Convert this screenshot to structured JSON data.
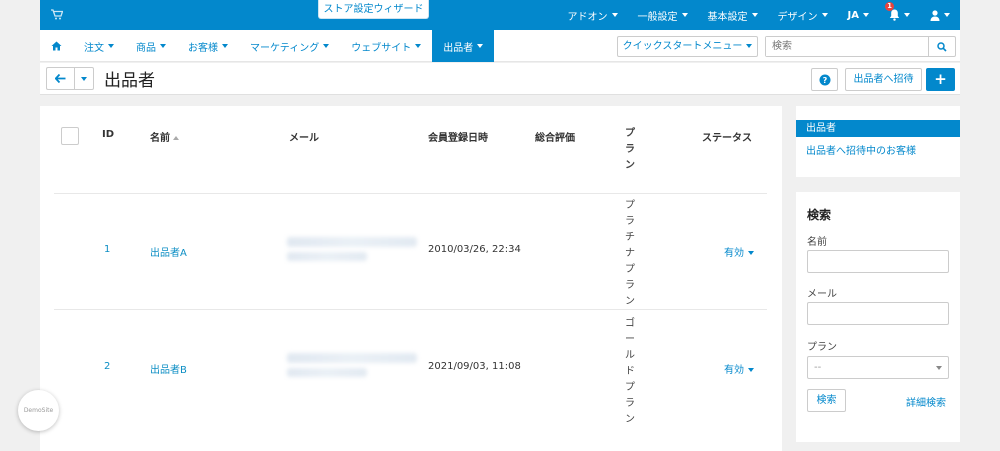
{
  "topbar": {
    "wizard_label": "ストア設定ウィザード",
    "nav": [
      {
        "label": "アドオン"
      },
      {
        "label": "一般設定"
      },
      {
        "label": "基本設定"
      },
      {
        "label": "デザイン"
      },
      {
        "label": "JA"
      }
    ],
    "notification_count": "1"
  },
  "subnav": {
    "items": [
      {
        "label": "注文"
      },
      {
        "label": "商品"
      },
      {
        "label": "お客様"
      },
      {
        "label": "マーケティング"
      },
      {
        "label": "ウェブサイト"
      },
      {
        "label": "出品者"
      }
    ],
    "quickstart_label": "クイックスタートメニュー",
    "search_placeholder": "検索"
  },
  "toolbar": {
    "title": "出品者",
    "help_label": "?",
    "invite_label": "出品者へ招待",
    "add_label": "+"
  },
  "table": {
    "headers": {
      "id": "ID",
      "name": "名前",
      "email": "メール",
      "registered": "会員登録日時",
      "rating": "総合評価",
      "plan": "プラン",
      "status": "ステータス"
    },
    "rows": [
      {
        "id": "1",
        "name": "出品者A",
        "registered": "2010/03/26, 22:34",
        "plan": "プラチナプラン",
        "status": "有効"
      },
      {
        "id": "2",
        "name": "出品者B",
        "registered": "2021/09/03, 11:08",
        "plan": "ゴールドプラン",
        "status": "有効"
      }
    ]
  },
  "sidebar": {
    "links": [
      {
        "label": "出品者"
      },
      {
        "label": "出品者へ招待中のお客様"
      }
    ],
    "search": {
      "heading": "検索",
      "name_label": "名前",
      "email_label": "メール",
      "plan_label": "プラン",
      "plan_value": "--",
      "search_button": "検索",
      "advanced_link": "詳細検索"
    }
  },
  "demo_badge": "DemoSite",
  "colors": {
    "accent": "#0388cc",
    "badge": "#e8433d",
    "link": "#0c8ec4"
  }
}
